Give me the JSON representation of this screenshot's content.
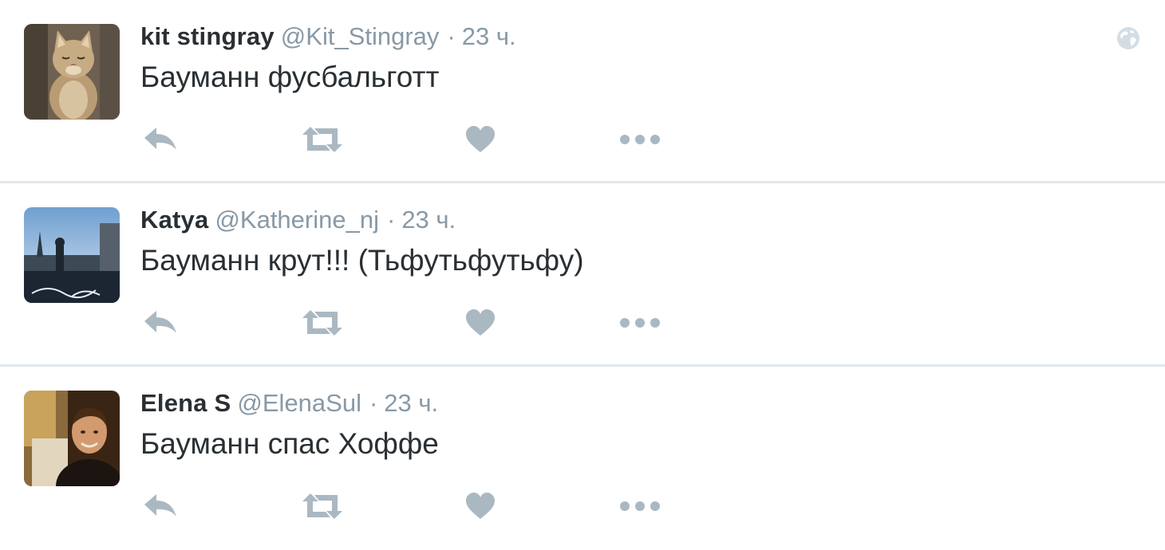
{
  "tweets": [
    {
      "fullname": "kit stingray",
      "username": "@Kit_Stingray",
      "separator": "·",
      "time": "23 ч.",
      "text": "Бауманн фусбальготт",
      "avatar_icon": "cat-avatar",
      "show_globe": true
    },
    {
      "fullname": "Katya",
      "username": "@Katherine_nj",
      "separator": "·",
      "time": "23 ч.",
      "text": "Бауманн крут!!! (Тьфутьфутьфу)",
      "avatar_icon": "city-avatar",
      "show_globe": false
    },
    {
      "fullname": "Elena S",
      "username": "@ElenaSul",
      "separator": "·",
      "time": "23 ч.",
      "text": "Бауманн спас Хоффе",
      "avatar_icon": "man-avatar",
      "show_globe": false
    }
  ],
  "action_icons": [
    "reply-icon",
    "retweet-icon",
    "like-icon",
    "more-icon"
  ],
  "colors": {
    "icon": "#aab8c2",
    "meta": "#8899a6",
    "text": "#292f33",
    "divider": "#e1e8ed"
  }
}
